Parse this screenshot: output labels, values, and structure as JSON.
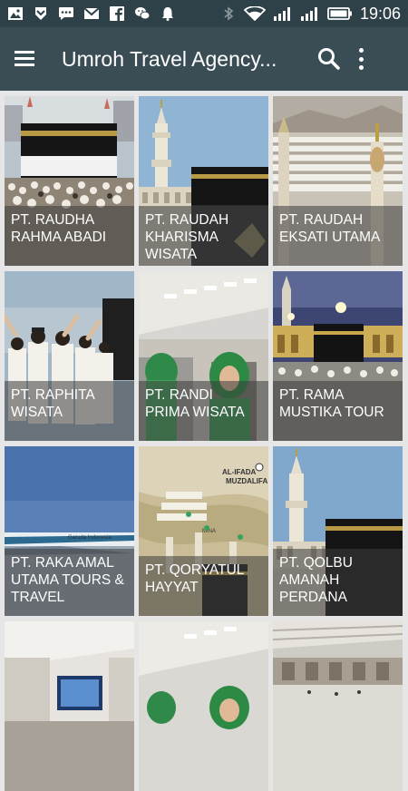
{
  "status_bar": {
    "time": "19:06"
  },
  "app_bar": {
    "title": "Umroh Travel Agency..."
  },
  "tiles": [
    {
      "label": "PT. RAUDHA RAHMA ABADI"
    },
    {
      "label": "PT. RAUDAH KHARISMA WISATA"
    },
    {
      "label": "PT. RAUDAH EKSATI UTAMA"
    },
    {
      "label": "PT. RAPHITA WISATA"
    },
    {
      "label": "PT. RANDI PRIMA WISATA"
    },
    {
      "label": "PT. RAMA MUSTIKA TOUR"
    },
    {
      "label": "PT. RAKA AMAL UTAMA TOURS & TRAVEL"
    },
    {
      "label": "PT. QORYATUL HAYYAT"
    },
    {
      "label": "PT. QOLBU AMANAH PERDANA"
    },
    {
      "label": ""
    },
    {
      "label": ""
    },
    {
      "label": ""
    }
  ],
  "map_labels": {
    "line1": "AL-IFADA",
    "line2": "MUZDALIFA",
    "mina": "MINA"
  },
  "plane_text": "Garuda Indonesia",
  "colors": {
    "status_bar": "#2f4148",
    "app_bar": "#3a4d55",
    "background": "#e6e6e6"
  }
}
